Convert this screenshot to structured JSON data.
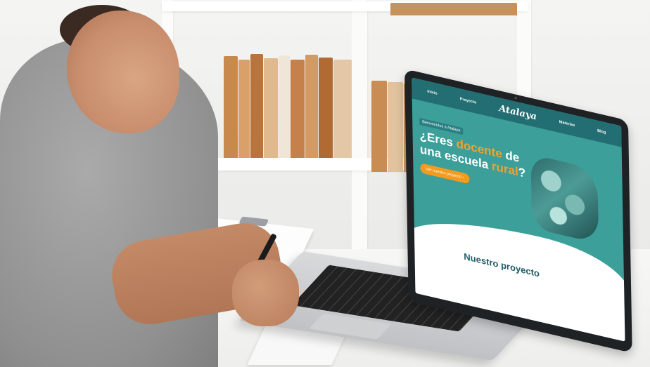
{
  "scene": {
    "description_icons": [
      "bookshelf-icon",
      "laptop-icon",
      "clipboard-icon",
      "pen-icon"
    ]
  },
  "website": {
    "logo": "Atalaya",
    "nav_items": [
      "Inicio",
      "Proyecto",
      "Materias",
      "Blog"
    ],
    "badge": "Bienvenidos a Atalaya",
    "hero_title_line1_a": "¿Eres ",
    "hero_title_line1_b": "docente",
    "hero_title_line1_c": " de",
    "hero_title_line2_a": "una escuela ",
    "hero_title_line2_b": "rural",
    "hero_title_line2_c": "?",
    "cta_label": "Ver nuestro proyecto  ›",
    "section_title": "Nuestro proyecto",
    "colors": {
      "teal": "#3c9f9a",
      "nav": "#236e72",
      "accent": "#f0a32c",
      "button": "#f29b1e"
    }
  }
}
